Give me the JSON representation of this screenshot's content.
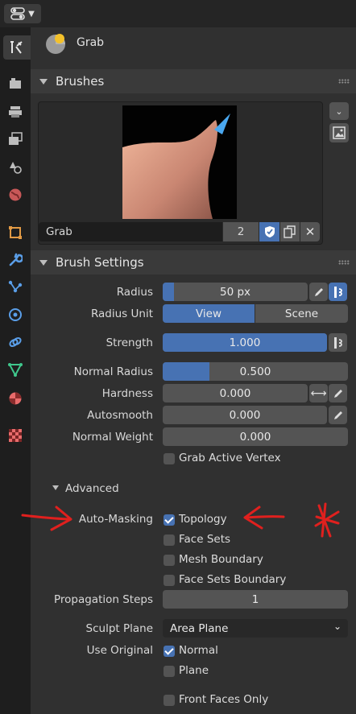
{
  "tool": {
    "name": "Grab"
  },
  "brushes_panel": {
    "title": "Brushes",
    "brush_name": "Grab",
    "user_count": "2"
  },
  "brush_settings": {
    "title": "Brush Settings",
    "radius": {
      "label": "Radius",
      "value": "50 px",
      "fraction": 0.08
    },
    "radius_unit": {
      "label": "Radius Unit",
      "options": [
        "View",
        "Scene"
      ],
      "selected": "View"
    },
    "strength": {
      "label": "Strength",
      "value": "1.000",
      "fraction": 1.0
    },
    "normal_radius": {
      "label": "Normal Radius",
      "value": "0.500",
      "fraction": 0.25
    },
    "hardness": {
      "label": "Hardness",
      "value": "0.000"
    },
    "autosmooth": {
      "label": "Autosmooth",
      "value": "0.000"
    },
    "normal_weight": {
      "label": "Normal Weight",
      "value": "0.000"
    },
    "grab_active_vertex": {
      "label": "Grab Active Vertex",
      "checked": false
    }
  },
  "advanced": {
    "title": "Advanced",
    "auto_masking_label": "Auto-Masking",
    "topology": {
      "label": "Topology",
      "checked": true
    },
    "face_sets": {
      "label": "Face Sets",
      "checked": false
    },
    "mesh_boundary": {
      "label": "Mesh Boundary",
      "checked": false
    },
    "face_sets_boundary": {
      "label": "Face Sets Boundary",
      "checked": false
    },
    "propagation_steps": {
      "label": "Propagation Steps",
      "value": "1"
    },
    "sculpt_plane": {
      "label": "Sculpt Plane",
      "value": "Area Plane"
    },
    "use_original_label": "Use Original",
    "normal": {
      "label": "Normal",
      "checked": true
    },
    "plane": {
      "label": "Plane",
      "checked": false
    },
    "front_faces_only": {
      "label": "Front Faces Only",
      "checked": false
    }
  },
  "colors": {
    "accent": "#4772b3",
    "annotation": "#e0201e"
  }
}
